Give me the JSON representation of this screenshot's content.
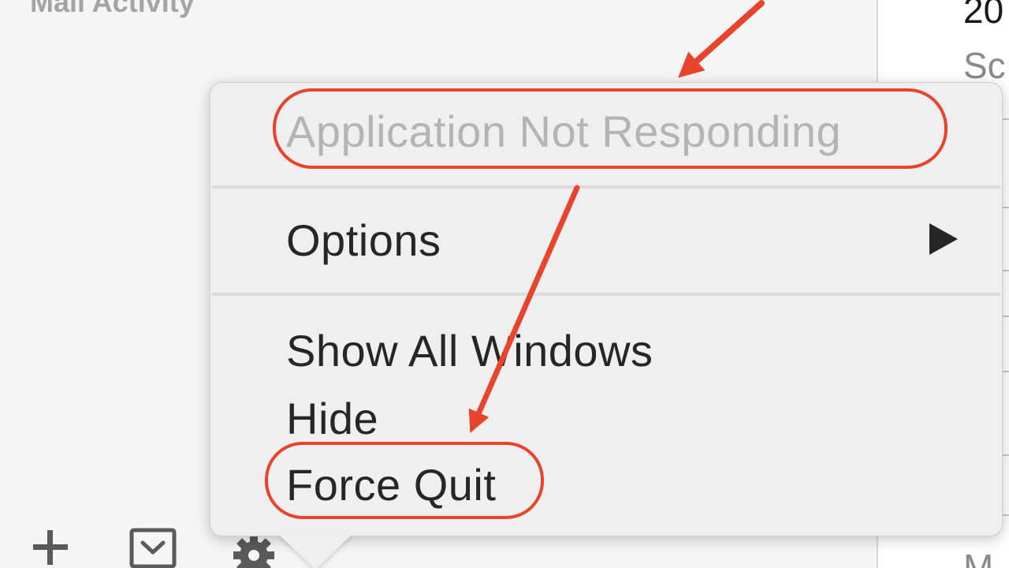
{
  "sidebar": {
    "heading": "Mail Activity",
    "icons": [
      "plus-icon",
      "dropdown-box-icon",
      "gear-icon"
    ]
  },
  "message_list": {
    "date_fragment": "20",
    "subject_fragment": "Sc",
    "footer_fragment": "M"
  },
  "context_menu": {
    "header": "Application Not Responding",
    "options_label": "Options",
    "show_all_windows_label": "Show All Windows",
    "hide_label": "Hide",
    "force_quit_label": "Force Quit"
  },
  "colors": {
    "annotation": "#e8442c",
    "menu_background": "#efefef",
    "disabled_text": "#b4b4b4",
    "menu_text": "#262626"
  }
}
